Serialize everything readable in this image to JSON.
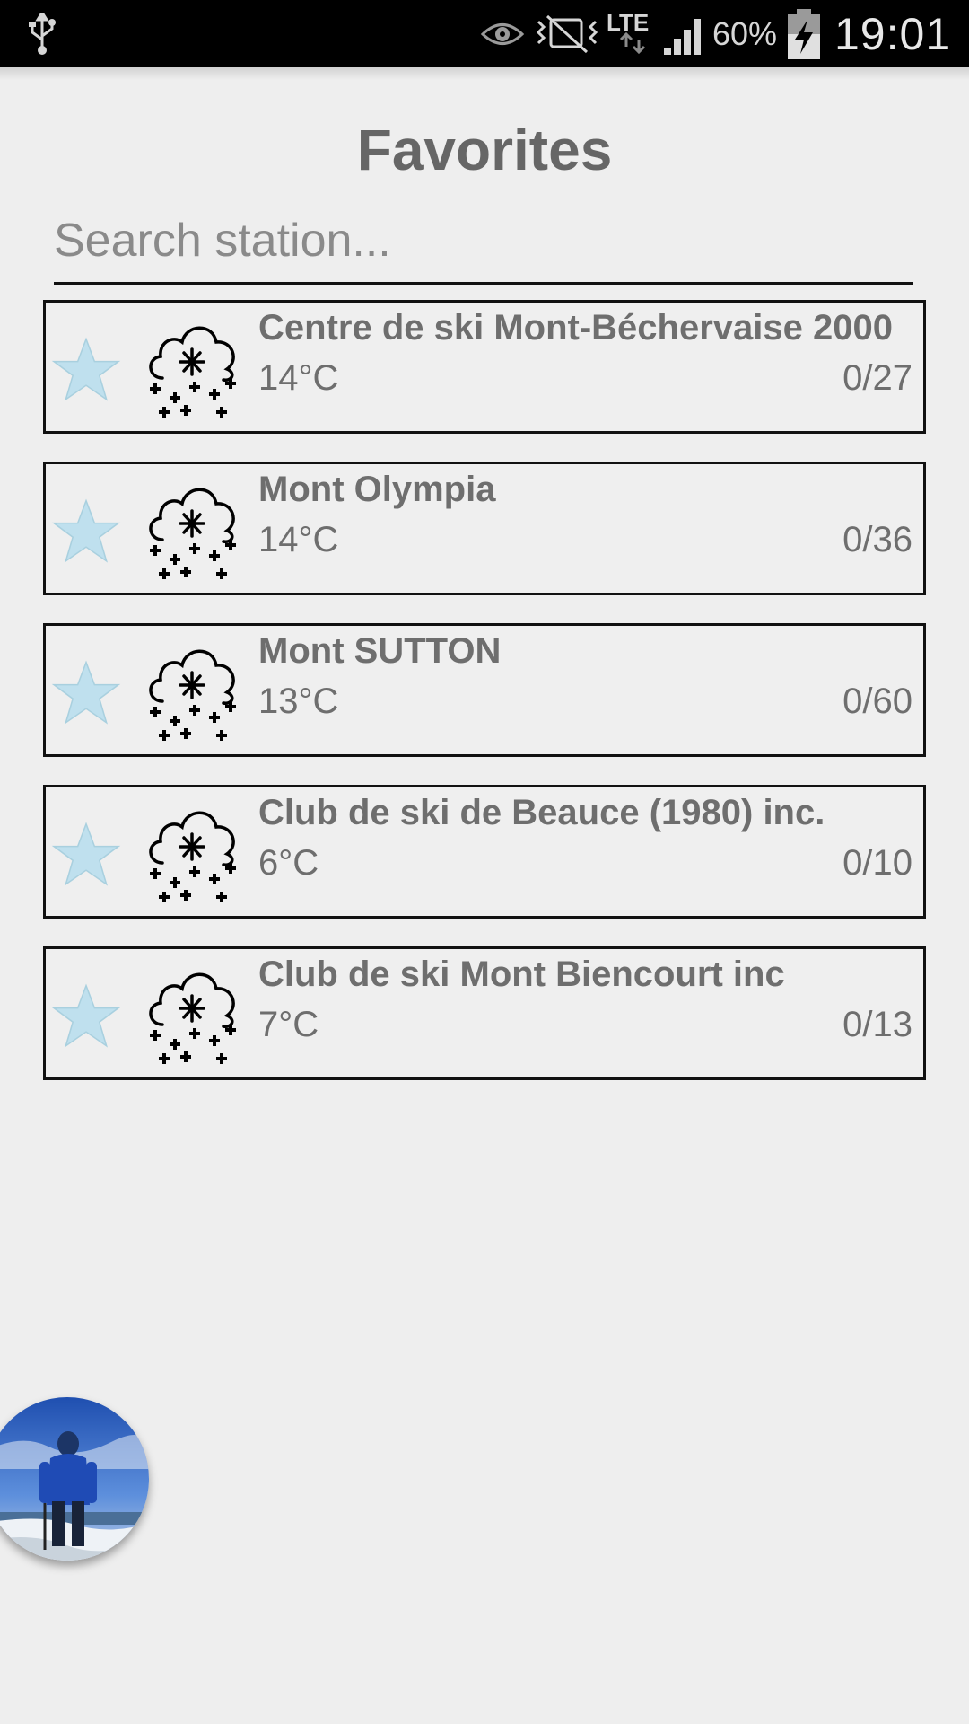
{
  "status_bar": {
    "battery_percent": "60%",
    "time": "19:01",
    "network": "LTE",
    "icons": [
      "usb-icon",
      "eye-icon",
      "vibrate-mute-icon",
      "lte-icon",
      "signal-icon",
      "battery-charging-icon"
    ]
  },
  "page": {
    "title": "Favorites"
  },
  "search": {
    "placeholder": "Search station...",
    "value": ""
  },
  "stations": [
    {
      "name": "Centre de ski Mont-Béchervaise 2000",
      "temp": "14°C",
      "count": "0/27",
      "icon": "snow-cloud-icon",
      "favorite_icon": "star-icon"
    },
    {
      "name": "Mont Olympia",
      "temp": "14°C",
      "count": "0/36",
      "icon": "snow-cloud-icon",
      "favorite_icon": "star-icon"
    },
    {
      "name": "Mont SUTTON",
      "temp": "13°C",
      "count": "0/60",
      "icon": "snow-cloud-icon",
      "favorite_icon": "star-icon"
    },
    {
      "name": "Club de ski de Beauce (1980) inc.",
      "temp": "6°C",
      "count": "0/10",
      "icon": "snow-cloud-icon",
      "favorite_icon": "star-icon"
    },
    {
      "name": "Club de ski Mont Biencourt inc",
      "temp": "7°C",
      "count": "0/13",
      "icon": "snow-cloud-icon",
      "favorite_icon": "star-icon"
    }
  ],
  "colors": {
    "background": "#eeeeee",
    "status_bar": "#000000",
    "text": "#6e6e6e",
    "title": "#666666",
    "star": "#bfe0ee",
    "border": "#111111"
  }
}
